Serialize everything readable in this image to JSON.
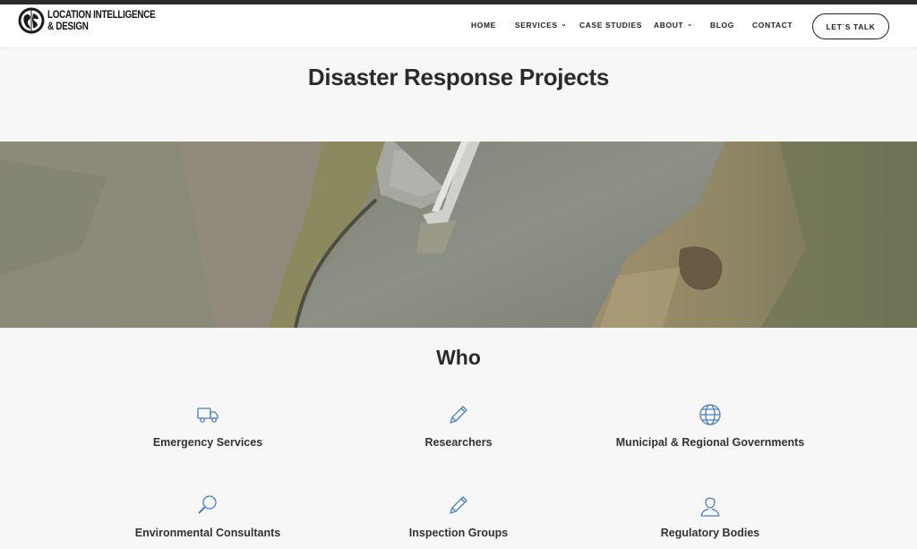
{
  "brand": {
    "line1": "LOCATION INTELLIGENCE",
    "line2": "& DESIGN"
  },
  "nav": {
    "items": [
      {
        "label": "HOME",
        "dropdown": false
      },
      {
        "label": "SERVICES",
        "dropdown": true
      },
      {
        "label": "CASE STUDIES",
        "dropdown": false
      },
      {
        "label": "ABOUT",
        "dropdown": true
      },
      {
        "label": "BLOG",
        "dropdown": false
      },
      {
        "label": "CONTACT",
        "dropdown": false
      }
    ],
    "cta_label": "LET`S TALK"
  },
  "page": {
    "title": "Disaster Response Projects",
    "hero_image": "aerial-river-photo"
  },
  "who": {
    "title": "Who",
    "items": [
      {
        "label": "Emergency Services",
        "icon": "truck-icon"
      },
      {
        "label": "Researchers",
        "icon": "pencil-icon"
      },
      {
        "label": "Municipal & Regional Governments",
        "icon": "globe-icon"
      },
      {
        "label": "Environmental Consultants",
        "icon": "magnifier-icon"
      },
      {
        "label": "Inspection Groups",
        "icon": "pencil-icon"
      },
      {
        "label": "Regulatory Bodies",
        "icon": "user-icon"
      }
    ]
  },
  "colors": {
    "accent_icon": "#4a7fc1",
    "text": "#333333",
    "background": "#f7f7f7"
  }
}
